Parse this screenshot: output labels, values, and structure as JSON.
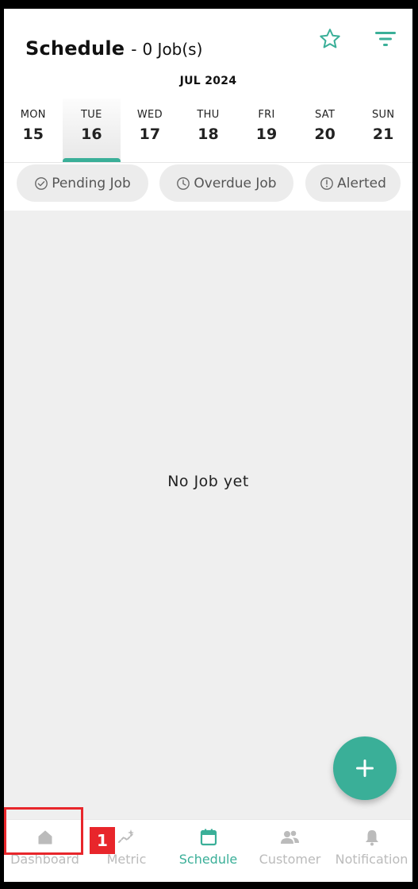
{
  "header": {
    "title": "Schedule",
    "separator": "-",
    "job_count": "0 Job(s)",
    "month": "JUL 2024"
  },
  "week": [
    {
      "name": "MON",
      "num": "15"
    },
    {
      "name": "TUE",
      "num": "16"
    },
    {
      "name": "WED",
      "num": "17"
    },
    {
      "name": "THU",
      "num": "18"
    },
    {
      "name": "FRI",
      "num": "19"
    },
    {
      "name": "SAT",
      "num": "20"
    },
    {
      "name": "SUN",
      "num": "21"
    }
  ],
  "filters": {
    "pending": "Pending Job",
    "overdue": "Overdue Job",
    "alerted": "Alerted"
  },
  "main": {
    "empty_text": "No Job yet"
  },
  "fab": {
    "label": "+"
  },
  "nav": {
    "dashboard": "Dashboard",
    "metric": "Metric",
    "schedule": "Schedule",
    "customer": "Customer",
    "notification": "Notification"
  },
  "annotation": {
    "marker": "1"
  },
  "colors": {
    "accent": "#3aaf98",
    "inactive": "#bbbbbb",
    "highlight": "#e8262b"
  }
}
